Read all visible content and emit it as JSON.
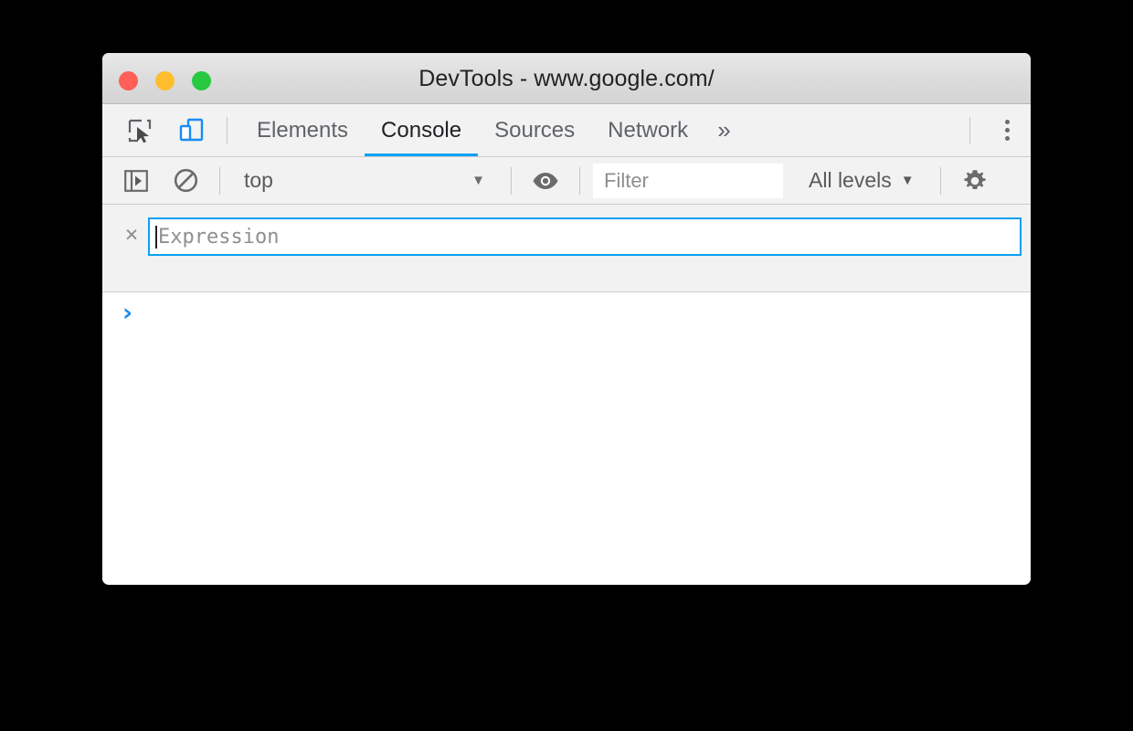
{
  "window": {
    "title": "DevTools - www.google.com/",
    "traffic_lights": [
      {
        "name": "close",
        "color": "#ff5f57"
      },
      {
        "name": "minimize",
        "color": "#ffbd2e"
      },
      {
        "name": "zoom",
        "color": "#28c940"
      }
    ]
  },
  "tabbar": {
    "inspect_icon": "inspect-element-icon",
    "device_icon": "device-toolbar-icon",
    "tabs": [
      {
        "label": "Elements",
        "active": false
      },
      {
        "label": "Console",
        "active": true
      },
      {
        "label": "Sources",
        "active": false
      },
      {
        "label": "Network",
        "active": false
      }
    ],
    "more_tabs_label": "»",
    "kebab_icon": "more-options-icon",
    "active_underline_color": "#0aa0f5"
  },
  "console_toolbar": {
    "sidebar_icon": "show-console-sidebar-icon",
    "clear_icon": "clear-console-icon",
    "context": {
      "value": "top",
      "caret": "▼"
    },
    "eye_icon": "create-live-expression-icon",
    "filter": {
      "value": "",
      "placeholder": "Filter"
    },
    "levels": {
      "value": "All levels",
      "caret": "▼"
    },
    "settings_icon": "settings-gear-icon"
  },
  "live_expression": {
    "close_label": "×",
    "value": "",
    "placeholder": "Expression",
    "focused": true,
    "border_color": "#0aa0f5"
  },
  "console_output": {
    "prompt_chevron": "›",
    "prompt_color": "#1a8cf0",
    "messages": []
  }
}
